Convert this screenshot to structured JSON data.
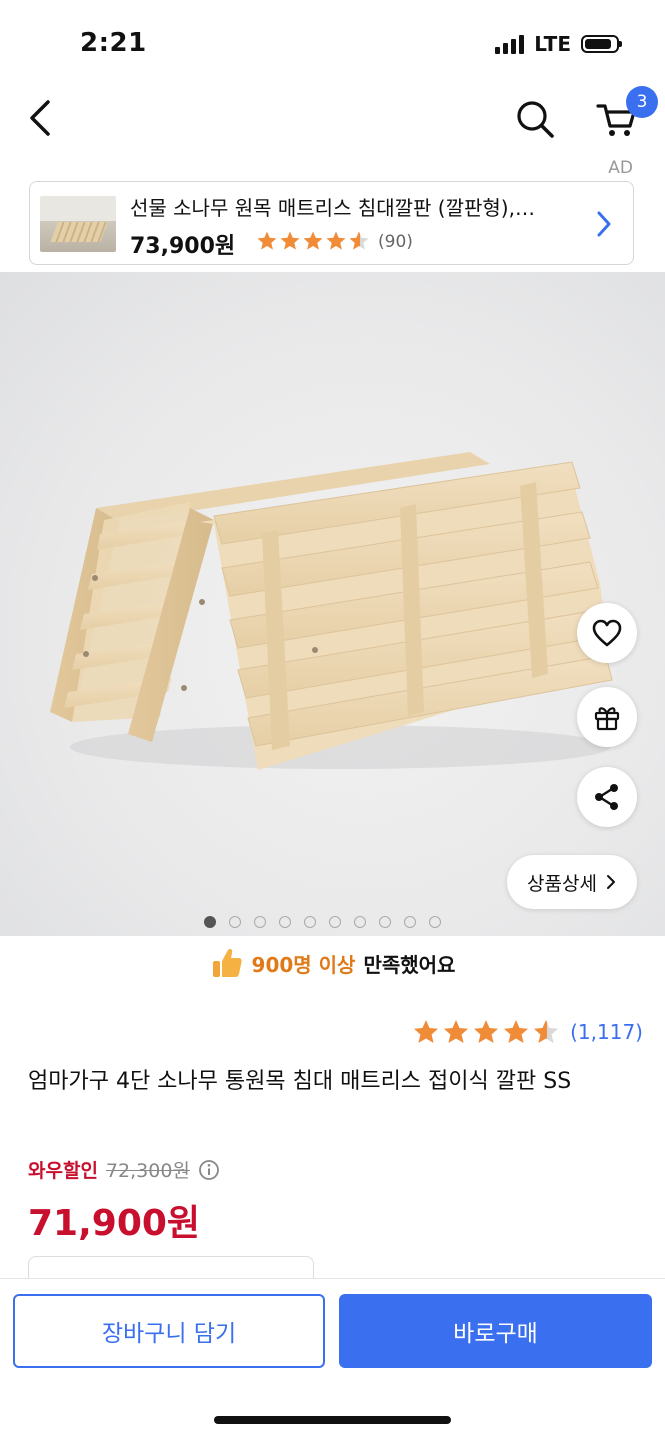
{
  "status_bar": {
    "time": "2:21",
    "network": "LTE"
  },
  "nav": {
    "back_icon": "chevron-left-icon",
    "search_icon": "search-icon",
    "cart_icon": "cart-icon",
    "cart_count": "3"
  },
  "ad": {
    "label": "AD",
    "title": "선물 소나무 원목 매트리스 침대깔판 (깔판형),…",
    "price": "73,900원",
    "rating": 4.5,
    "reviews": "(90)"
  },
  "gallery": {
    "image_count": 10,
    "current_index": 0,
    "detail_label": "상품상세",
    "side_actions": [
      "heart-icon",
      "gift-icon",
      "share-icon"
    ]
  },
  "satisfaction": {
    "highlight": "900명 이상",
    "text": "만족했어요",
    "icon": "thumbs-up-icon"
  },
  "product": {
    "rating": 4.5,
    "review_count": "(1,117)",
    "title": "엄마가구 4단 소나무 통원목 침대 매트리스 접이식 깔판 SS",
    "wow_label": "와우할인",
    "original_price": "72,300원",
    "final_price": "71,900원"
  },
  "actions": {
    "add_to_cart": "장바구니 담기",
    "buy_now": "바로구매"
  },
  "colors": {
    "accent": "#3a6ff0",
    "price_red": "#c8102e",
    "star": "#f08c38",
    "satisfy_orange": "#e07a18"
  }
}
